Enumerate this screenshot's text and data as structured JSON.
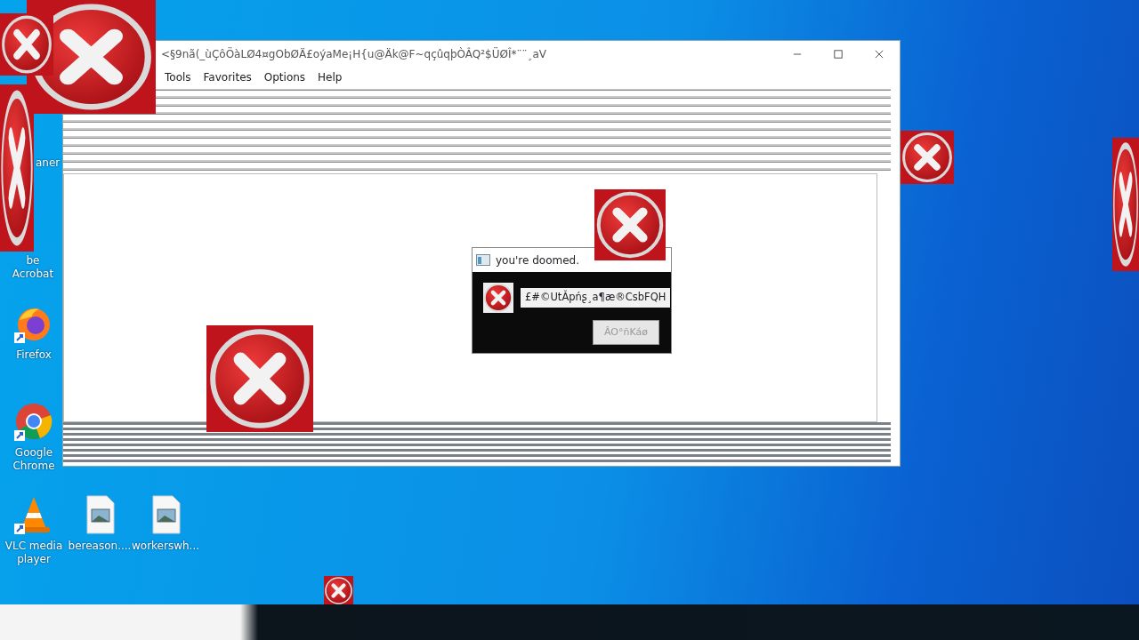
{
  "window": {
    "title": "<§9nã(_ùÇôÖàLØ4¤gObØÄ£oýaMe¡H{u@Äk@F~qçûqþÒÂQ²$ÜØÎ*¨¨¸aV",
    "menu": [
      "Tools",
      "Favorites",
      "Options",
      "Help"
    ]
  },
  "dialog": {
    "title": "you're doomed.",
    "message": "£#©UtǍpńʂ¸a¶æ®CsbFQH",
    "button": {
      "label": "ÂO°ñKáø",
      "disabled": true
    }
  },
  "desktop_icons": [
    {
      "label": "aner",
      "kind": "app"
    },
    {
      "label": "be Acrobat",
      "kind": "acrobat"
    },
    {
      "label": "Firefox",
      "kind": "firefox"
    },
    {
      "label": "Google Chrome",
      "kind": "chrome"
    },
    {
      "label": "VLC media player",
      "kind": "vlc"
    },
    {
      "label": "bereason....",
      "kind": "image"
    },
    {
      "label": "workerswh...",
      "kind": "image"
    }
  ]
}
